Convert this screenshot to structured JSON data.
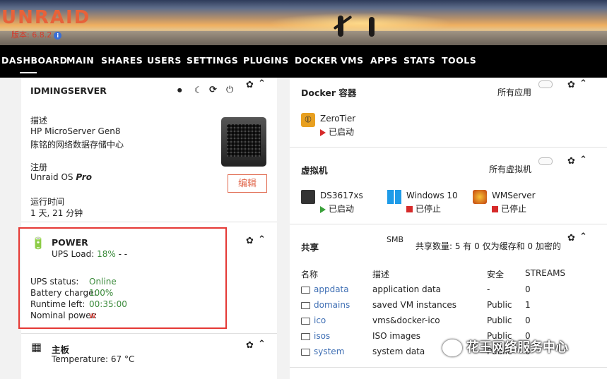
{
  "header": {
    "logo": "UNRAID",
    "version": "版本: 6.8.2"
  },
  "nav": [
    "DASHBOARD",
    "MAIN",
    "SHARES",
    "USERS",
    "SETTINGS",
    "PLUGINS",
    "DOCKER",
    "VMS",
    "APPS",
    "STATS",
    "TOOLS"
  ],
  "server": {
    "name": "IDMINGSERVER",
    "desc_label": "描述",
    "desc_model": "HP MicroServer Gen8",
    "desc_text": "陈铭的网络数据存储中心",
    "reg_label": "注册",
    "reg_value": "Unraid OS",
    "reg_edition": "Pro",
    "uptime_label": "运行时间",
    "uptime_value": "1 天, 21 分钟",
    "edit_button": "编辑"
  },
  "power": {
    "title": "POWER",
    "ups_load_label": "UPS Load:",
    "ups_load_value": "18%",
    "ups_load_extra": "- -",
    "rows": [
      {
        "label": "UPS status:",
        "value": "Online"
      },
      {
        "label": "Battery charge:",
        "value": "100%"
      },
      {
        "label": "Runtime left:",
        "value": "00:35:00"
      },
      {
        "label": "Nominal power:",
        "value": "w"
      }
    ]
  },
  "board": {
    "title": "主板",
    "temperature": "Temperature: 67 °C"
  },
  "docker": {
    "title": "Docker 容器",
    "toggle_label": "所有应用",
    "containers": [
      {
        "name": "ZeroTier",
        "status": "已启动"
      }
    ]
  },
  "vms": {
    "title": "虚拟机",
    "toggle_label": "所有虚拟机",
    "items": [
      {
        "name": "DS3617xs",
        "status": "已启动",
        "state": "started"
      },
      {
        "name": "Windows 10",
        "status": "已停止",
        "state": "stopped"
      },
      {
        "name": "WMServer",
        "status": "已停止",
        "state": "stopped"
      }
    ]
  },
  "shares": {
    "title": "共享",
    "smb_label": "SMB",
    "summary": "共享数量: 5 有 0 仅为缓存和 0 加密的",
    "columns": [
      "名称",
      "描述",
      "安全",
      "STREAMS"
    ],
    "rows": [
      {
        "name": "appdata",
        "desc": "application data",
        "security": "-",
        "streams": "0"
      },
      {
        "name": "domains",
        "desc": "saved VM instances",
        "security": "Public",
        "streams": "1"
      },
      {
        "name": "ico",
        "desc": "vms&docker-ico",
        "security": "Public",
        "streams": "0"
      },
      {
        "name": "isos",
        "desc": "ISO images",
        "security": "Public",
        "streams": "0"
      },
      {
        "name": "system",
        "desc": "system data",
        "security": "Public",
        "streams": "0"
      }
    ]
  },
  "watermark": "花王网络服务中心",
  "colors": {
    "accent": "#e7623a",
    "green": "#3a8a3a",
    "red": "#d62a2a",
    "link": "#3f6fb4",
    "highlight": "#e53935"
  }
}
